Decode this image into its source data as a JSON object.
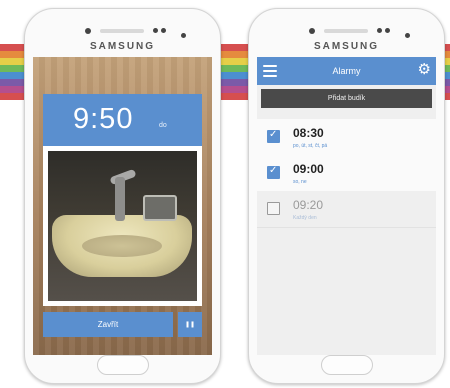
{
  "device": {
    "brand": "SAMSUNG"
  },
  "colors": {
    "accent": "#5a8fcf",
    "add_button": "#4a4a4a",
    "stripes": [
      "#d64f4f",
      "#e58b3e",
      "#e6cf48",
      "#6fb95a",
      "#4c8fd0",
      "#7b5aa8",
      "#b44f8e",
      "#d64f4f"
    ]
  },
  "alarm_ringing": {
    "time": "9:50",
    "ampm": "do",
    "close_label": "Zavřít",
    "pause_icon": "pause-icon",
    "pause_glyph": "❚❚"
  },
  "alarm_list": {
    "title": "Alarmy",
    "menu_icon": "menu-icon",
    "settings_icon": "gear-icon",
    "settings_glyph": "⚙",
    "add_label": "Přidat budík",
    "alarms": [
      {
        "time": "08:30",
        "days": "po, út, st, čt, pá",
        "enabled": true,
        "check": "✓"
      },
      {
        "time": "09:00",
        "days": "so, ne",
        "enabled": true,
        "check": "✓"
      },
      {
        "time": "09:20",
        "days": "Každý den",
        "enabled": false,
        "check": ""
      }
    ]
  }
}
